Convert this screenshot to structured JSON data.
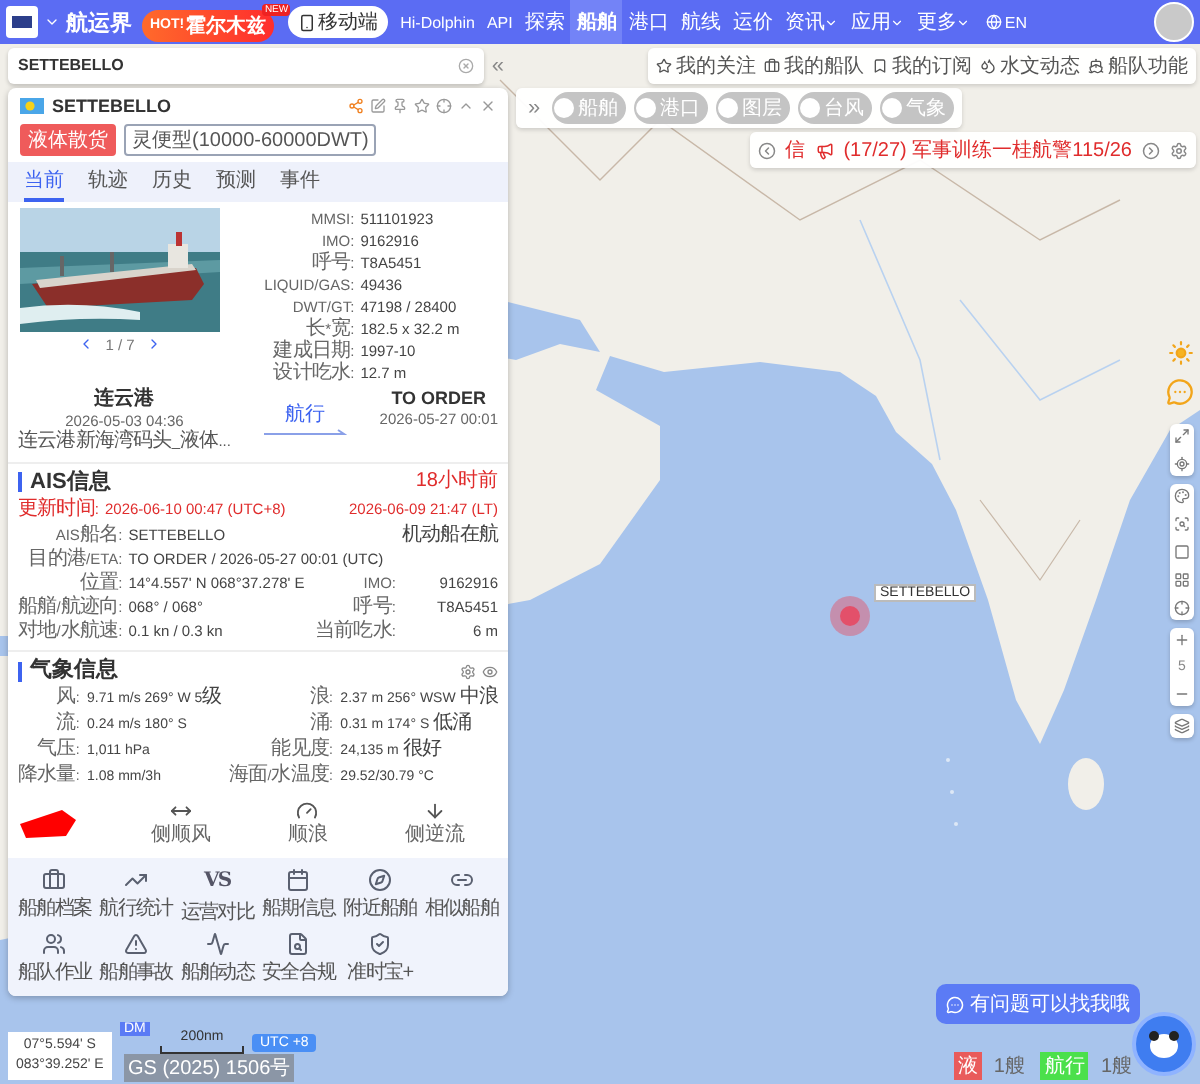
{
  "nav": {
    "brand": "航运界",
    "hot": {
      "badge": "HOT!",
      "text": "霍尔木兹"
    },
    "new_badge": "NEW",
    "mobile": "移动端",
    "language": "EN",
    "items": [
      {
        "label": "Hi-Dolphin",
        "selected": false,
        "dropdown": false
      },
      {
        "label": "API",
        "selected": false,
        "dropdown": false
      },
      {
        "label": "探索",
        "selected": false,
        "dropdown": false
      },
      {
        "label": "船舶",
        "selected": true,
        "dropdown": false
      },
      {
        "label": "港口",
        "selected": false,
        "dropdown": false
      },
      {
        "label": "航线",
        "selected": false,
        "dropdown": false
      },
      {
        "label": "运价",
        "selected": false,
        "dropdown": false
      },
      {
        "label": "资讯",
        "selected": false,
        "dropdown": true
      },
      {
        "label": "应用",
        "selected": false,
        "dropdown": true
      },
      {
        "label": "更多",
        "selected": false,
        "dropdown": true
      }
    ]
  },
  "search": {
    "value": "SETTEBELLO",
    "collapse": "«"
  },
  "layers": {
    "expand": "»",
    "toggles": [
      {
        "label": "船舶",
        "on": false
      },
      {
        "label": "港口",
        "on": false
      },
      {
        "label": "图层",
        "on": false
      },
      {
        "label": "台风",
        "on": false
      },
      {
        "label": "气象",
        "on": false
      }
    ]
  },
  "quick_links": [
    "我的关注",
    "我的船队",
    "我的订阅",
    "水文动态",
    "船队功能"
  ],
  "notice": {
    "tag": "信",
    "text": "(17/27) 军事训练一桂航警115/26"
  },
  "vessel": {
    "name": "SETTEBELLO",
    "tags": [
      {
        "label": "液体散货",
        "kind": "filled"
      },
      {
        "label": "灵便型(10000-60000DWT)",
        "kind": "outline"
      }
    ],
    "tabs": [
      {
        "label": "当前",
        "selected": true
      },
      {
        "label": "轨迹",
        "selected": false
      },
      {
        "label": "历史",
        "selected": false
      },
      {
        "label": "预测",
        "selected": false
      },
      {
        "label": "事件",
        "selected": false
      }
    ],
    "photo_counter": "1 / 7",
    "specs": [
      {
        "label": "MMSI:",
        "value": "511101923"
      },
      {
        "label": "IMO:",
        "value": "9162916"
      },
      {
        "label": "呼号:",
        "value": "T8A5451"
      },
      {
        "label": "LIQUID/GAS:",
        "value": "49436"
      },
      {
        "label": "DWT/GT:",
        "value": "47198 / 28400"
      },
      {
        "label": "长*宽:",
        "value": "182.5 x 32.2 m"
      },
      {
        "label": "建成日期:",
        "value": "1997-10"
      },
      {
        "label": "设计吃水:",
        "value": "12.7 m"
      }
    ],
    "departure": {
      "port": "连云港",
      "time": "2026-05-03 04:36",
      "berth": "连云港新海湾码头_液体..."
    },
    "status": "航行",
    "destination": {
      "port": "TO ORDER",
      "time": "2026-05-27 00:01"
    }
  },
  "ais": {
    "title": "AIS信息",
    "age": "18小时前",
    "update_label": "更新时间:",
    "update_utc": "2026-06-10 00:47 (UTC+8)",
    "update_lt": "2026-06-09 21:47 (LT)",
    "rows": [
      {
        "label": "AIS船名:",
        "value": "SETTEBELLO",
        "right_value": "机动船在航"
      },
      {
        "label": "目的港/ETA:",
        "value": "TO ORDER / 2026-05-27 00:01 (UTC)"
      },
      {
        "label": "位置:",
        "value": "14°4.557' N  068°37.278' E",
        "right_label": "IMO:",
        "right_value": "9162916"
      },
      {
        "label": "船艏/航迹向:",
        "value": "068° / 068°",
        "right_label": "呼号:",
        "right_value": "T8A5451"
      },
      {
        "label": "对地/水航速:",
        "value": "0.1 kn / 0.3 kn",
        "right_label": "当前吃水:",
        "right_value": "6 m"
      }
    ]
  },
  "weather": {
    "title": "气象信息",
    "rows": [
      {
        "label": "风:",
        "value": "9.71 m/s 269° W 5级",
        "right_label": "浪:",
        "right_value": "2.37 m 256° WSW 中浪"
      },
      {
        "label": "流:",
        "value": "0.24 m/s 180° S",
        "right_label": "涌:",
        "right_value": "0.31 m 174° S 低涌"
      },
      {
        "label": "气压:",
        "value": "1,011 hPa",
        "right_label": "能见度:",
        "right_value": "24,135 m 很好"
      },
      {
        "label": "降水量:",
        "value": "1.08 mm/3h",
        "right_label": "海面/水温度:",
        "right_value": "29.52/30.79 °C"
      }
    ],
    "indicators": [
      "侧顺风",
      "顺浪",
      "侧逆流"
    ]
  },
  "functions": [
    {
      "label": "船舶档案"
    },
    {
      "label": "航行统计"
    },
    {
      "label": "运营对比",
      "glyph": "VS"
    },
    {
      "label": "船期信息"
    },
    {
      "label": "附近船舶"
    },
    {
      "label": "相似船舶"
    },
    {
      "label": "船队作业"
    },
    {
      "label": "船舶事故"
    },
    {
      "label": "船舶动态"
    },
    {
      "label": "安全合规"
    },
    {
      "label": "准时宝+"
    }
  ],
  "map": {
    "vessel_label": "SETTEBELLO",
    "zoom": "5",
    "position": [
      "07°5.594' S",
      "083°39.252' E"
    ],
    "dm": "DM",
    "scale": "200nm",
    "timezone": "UTC +8",
    "copyright": "GS (2025) 1506号",
    "legend": [
      {
        "tag": "液",
        "count": "1艘",
        "color": "#e95b5b"
      },
      {
        "tag": "航行",
        "count": "1艘",
        "color": "#4be04b"
      }
    ],
    "chat": "有问题可以找我哦"
  }
}
